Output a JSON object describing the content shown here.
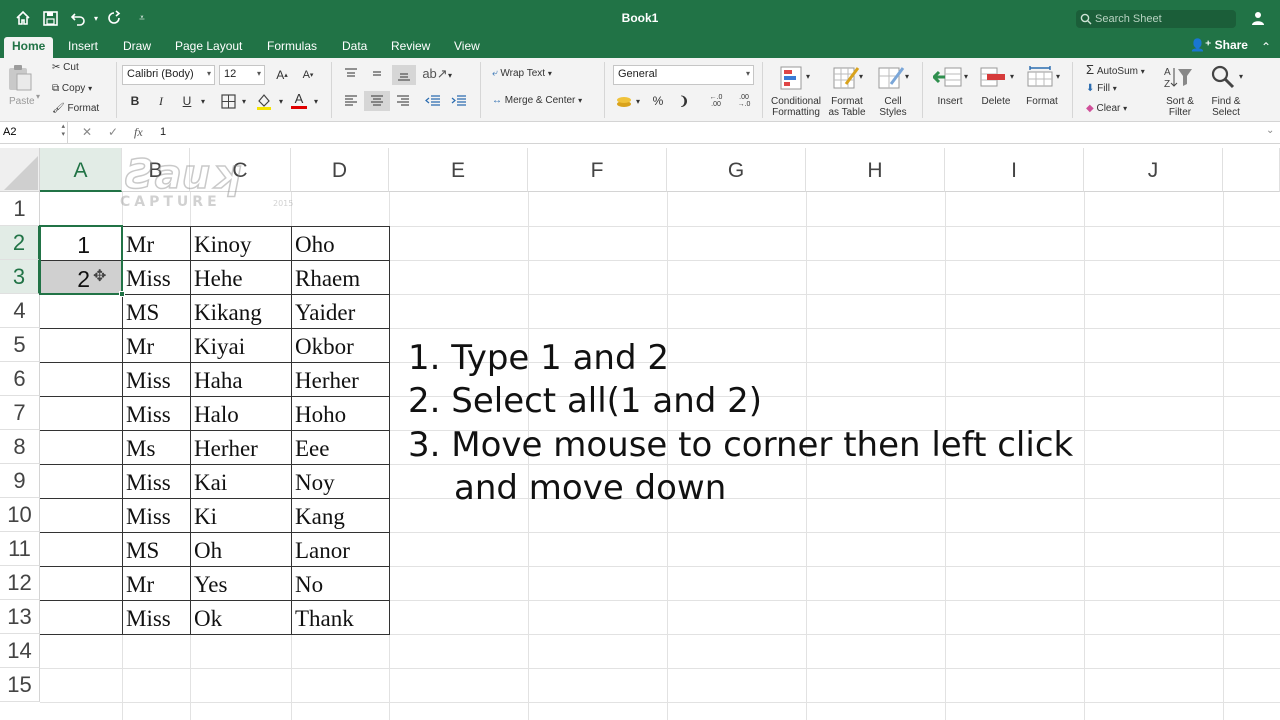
{
  "window": {
    "title": "Book1",
    "search_placeholder": "Search Sheet",
    "share_label": "Share"
  },
  "tabs": [
    "Home",
    "Insert",
    "Draw",
    "Page Layout",
    "Formulas",
    "Data",
    "Review",
    "View"
  ],
  "ribbon": {
    "clipboard": {
      "paste": "Paste",
      "cut": "Cut",
      "copy": "Copy",
      "format": "Format"
    },
    "font": {
      "name": "Calibri (Body)",
      "size": "12",
      "bold": "B",
      "italic": "I",
      "underline": "U"
    },
    "alignment": {
      "wrap_text": "Wrap Text",
      "merge_center": "Merge & Center"
    },
    "number": {
      "format": "General",
      "percent": "%",
      "comma": "❩"
    },
    "styles": {
      "conditional_line1": "Conditional",
      "conditional_line2": "Formatting",
      "table_line1": "Format",
      "table_line2": "as Table",
      "cell_line1": "Cell",
      "cell_line2": "Styles"
    },
    "cells": {
      "insert": "Insert",
      "delete": "Delete",
      "format": "Format"
    },
    "editing": {
      "autosum": "AutoSum",
      "fill": "Fill",
      "clear": "Clear",
      "sort_line1": "Sort &",
      "sort_line2": "Filter",
      "find_line1": "Find &",
      "find_line2": "Select"
    }
  },
  "formula_bar": {
    "name_box": "A2",
    "fx": "fx",
    "value": "1"
  },
  "columns": [
    "A",
    "B",
    "C",
    "D",
    "E",
    "F",
    "G",
    "H",
    "I",
    "J"
  ],
  "rows": [
    "1",
    "2",
    "3",
    "4",
    "5",
    "6",
    "7",
    "8",
    "9",
    "10",
    "11",
    "12",
    "13",
    "14",
    "15"
  ],
  "sheet": {
    "col_a": [
      "",
      "1",
      "2",
      "",
      "",
      "",
      "",
      "",
      "",
      "",
      "",
      "",
      ""
    ],
    "col_b": [
      "",
      "Mr",
      "Miss",
      "MS",
      "Mr",
      "Miss",
      "Miss",
      "Ms",
      "Miss",
      "Miss",
      "MS",
      "Mr",
      "Miss"
    ],
    "col_c": [
      "",
      "Kinoy",
      "Hehe",
      "Kikang",
      "Kiyai",
      "Haha",
      "Halo",
      "Herher",
      "Kai",
      "Ki",
      "Oh",
      "Yes",
      "Ok"
    ],
    "col_d": [
      "",
      "Oho",
      "Rhaem",
      "Yaider",
      "Okbor",
      "Herher",
      "Hoho",
      "Eee",
      "Noy",
      "Kang",
      "Lanor",
      "No",
      "Thank"
    ]
  },
  "instructions": [
    "1. Type 1 and 2",
    "2. Select all(1 and 2)",
    "3. Move mouse to corner then left click",
    "and move down"
  ],
  "colors": {
    "excel_green": "#217346"
  }
}
